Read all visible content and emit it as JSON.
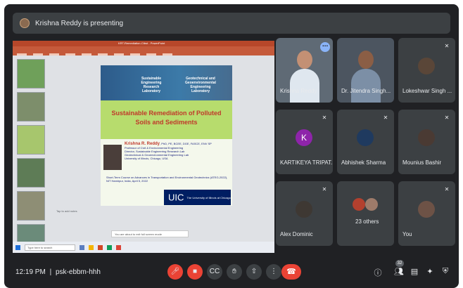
{
  "presenter_bar": {
    "text": "Krishna Reddy is presenting"
  },
  "shared_screen": {
    "window_title": "KRT-Remediation-Ctbst - PowerPoint",
    "slide": {
      "lab_left": "Sustainable Engineering Research Laboratory",
      "lab_right": "Geotechnical and Geoenvironmental Engineering Laboratory",
      "title": "Sustainable Remediation of Polluted Soils and Sediments",
      "speaker": "Krishna R. Reddy",
      "credentials": ", PhD, PE, BCEE, DGE, FASCE, ENV SP",
      "bio_lines": [
        "Professor of Civil & Environmental Engineering",
        "Director, Sustainable Engineering Research Lab",
        "Geotechnical & Geoenvironmental Engineering Lab",
        "University of Illinois, Chicago, USA"
      ],
      "course_line": "Short-Term Course on Advances in Transportation and Environmental Geotechnics (ATEG-2022), NIT Hamirpur, India, April 5, 2022",
      "uic_logo": "UIC",
      "uic_text": "The University of Illinois at Chicago"
    },
    "notes_hint": "Tap to add notes",
    "toast_text": "You are about to exit full screen mode",
    "taskbar_search": "Type here to search"
  },
  "participants": [
    {
      "name": "Krishna Reddy",
      "kind": "video",
      "skin": "#c39074",
      "shirt": "#dfe7ef"
    },
    {
      "name": "Dr. Jitendra Singh...",
      "kind": "video",
      "skin": "#8b5e45",
      "shirt": "#7c8fa6"
    },
    {
      "name": "Lokeshwar Singh ...",
      "kind": "photo"
    },
    {
      "name": "KARTIKEYA TRIPAT...",
      "kind": "letter",
      "letter": "K",
      "color": "#8e24aa"
    },
    {
      "name": "Abhishek Sharma",
      "kind": "photo"
    },
    {
      "name": "Mounius Bashir",
      "kind": "photo"
    },
    {
      "name": "Alex Dominic",
      "kind": "photo"
    },
    {
      "name": "23 others",
      "kind": "group"
    },
    {
      "name": "You",
      "kind": "photo"
    }
  ],
  "toolbar": {
    "time": "12:19 PM",
    "separator": "|",
    "meeting_code": "psk-ebbm-hhh",
    "people_count": "32"
  },
  "colors": {
    "background": "#202124",
    "tile": "#3c4043",
    "danger": "#ea4335",
    "accent": "#8ab4f8"
  },
  "icons": {
    "mic_off": "mic-off-icon",
    "cam_off": "camera-off-icon",
    "captions": "captions-icon",
    "raise_hand": "raise-hand-icon",
    "present": "present-icon",
    "more": "more-options-icon",
    "hangup": "hang-up-icon",
    "info": "info-icon",
    "people": "people-icon",
    "chat": "chat-icon",
    "activities": "activities-icon",
    "host_controls": "host-controls-icon"
  }
}
